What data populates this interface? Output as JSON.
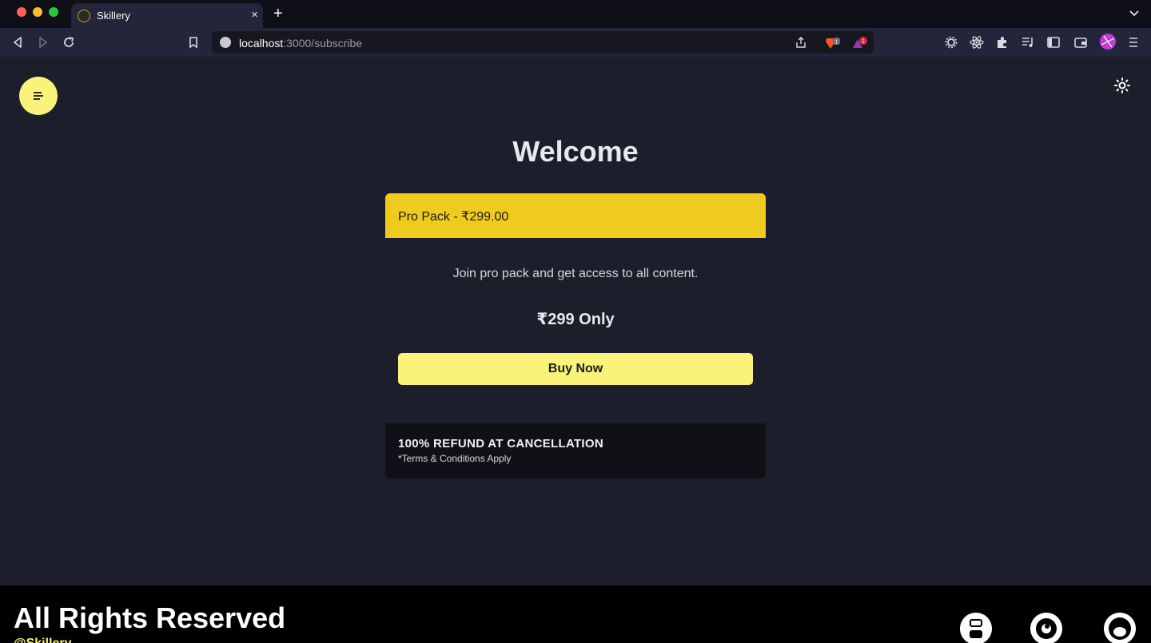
{
  "browser": {
    "tab_title": "Skillery",
    "tab_close": "×",
    "new_tab": "+",
    "url_host": "localhost",
    "url_path": ":3000/subscribe",
    "brave_shield_count": "1",
    "brave_rewards_count": "1"
  },
  "header": {
    "menu_icon": "menu-icon",
    "theme_icon": "sun-icon"
  },
  "main": {
    "title": "Welcome",
    "pack_title": "Pro Pack - ₹299.00",
    "description": "Join pro pack and get access to all content.",
    "price": "₹299 Only",
    "buy_label": "Buy Now",
    "refund_title": "100% REFUND AT CANCELLATION",
    "refund_note": "*Terms & Conditions Apply"
  },
  "footer": {
    "title": "All Rights Reserved",
    "brand": "@Skillery",
    "social": [
      "youtube-icon",
      "dribbble-icon",
      "github-icon"
    ]
  },
  "colors": {
    "page_bg": "#1c1f2b",
    "accent_yellow": "#f9f37a",
    "pack_yellow": "#efcb1d",
    "refund_bg": "#0f1117",
    "footer_bg": "#000000"
  }
}
